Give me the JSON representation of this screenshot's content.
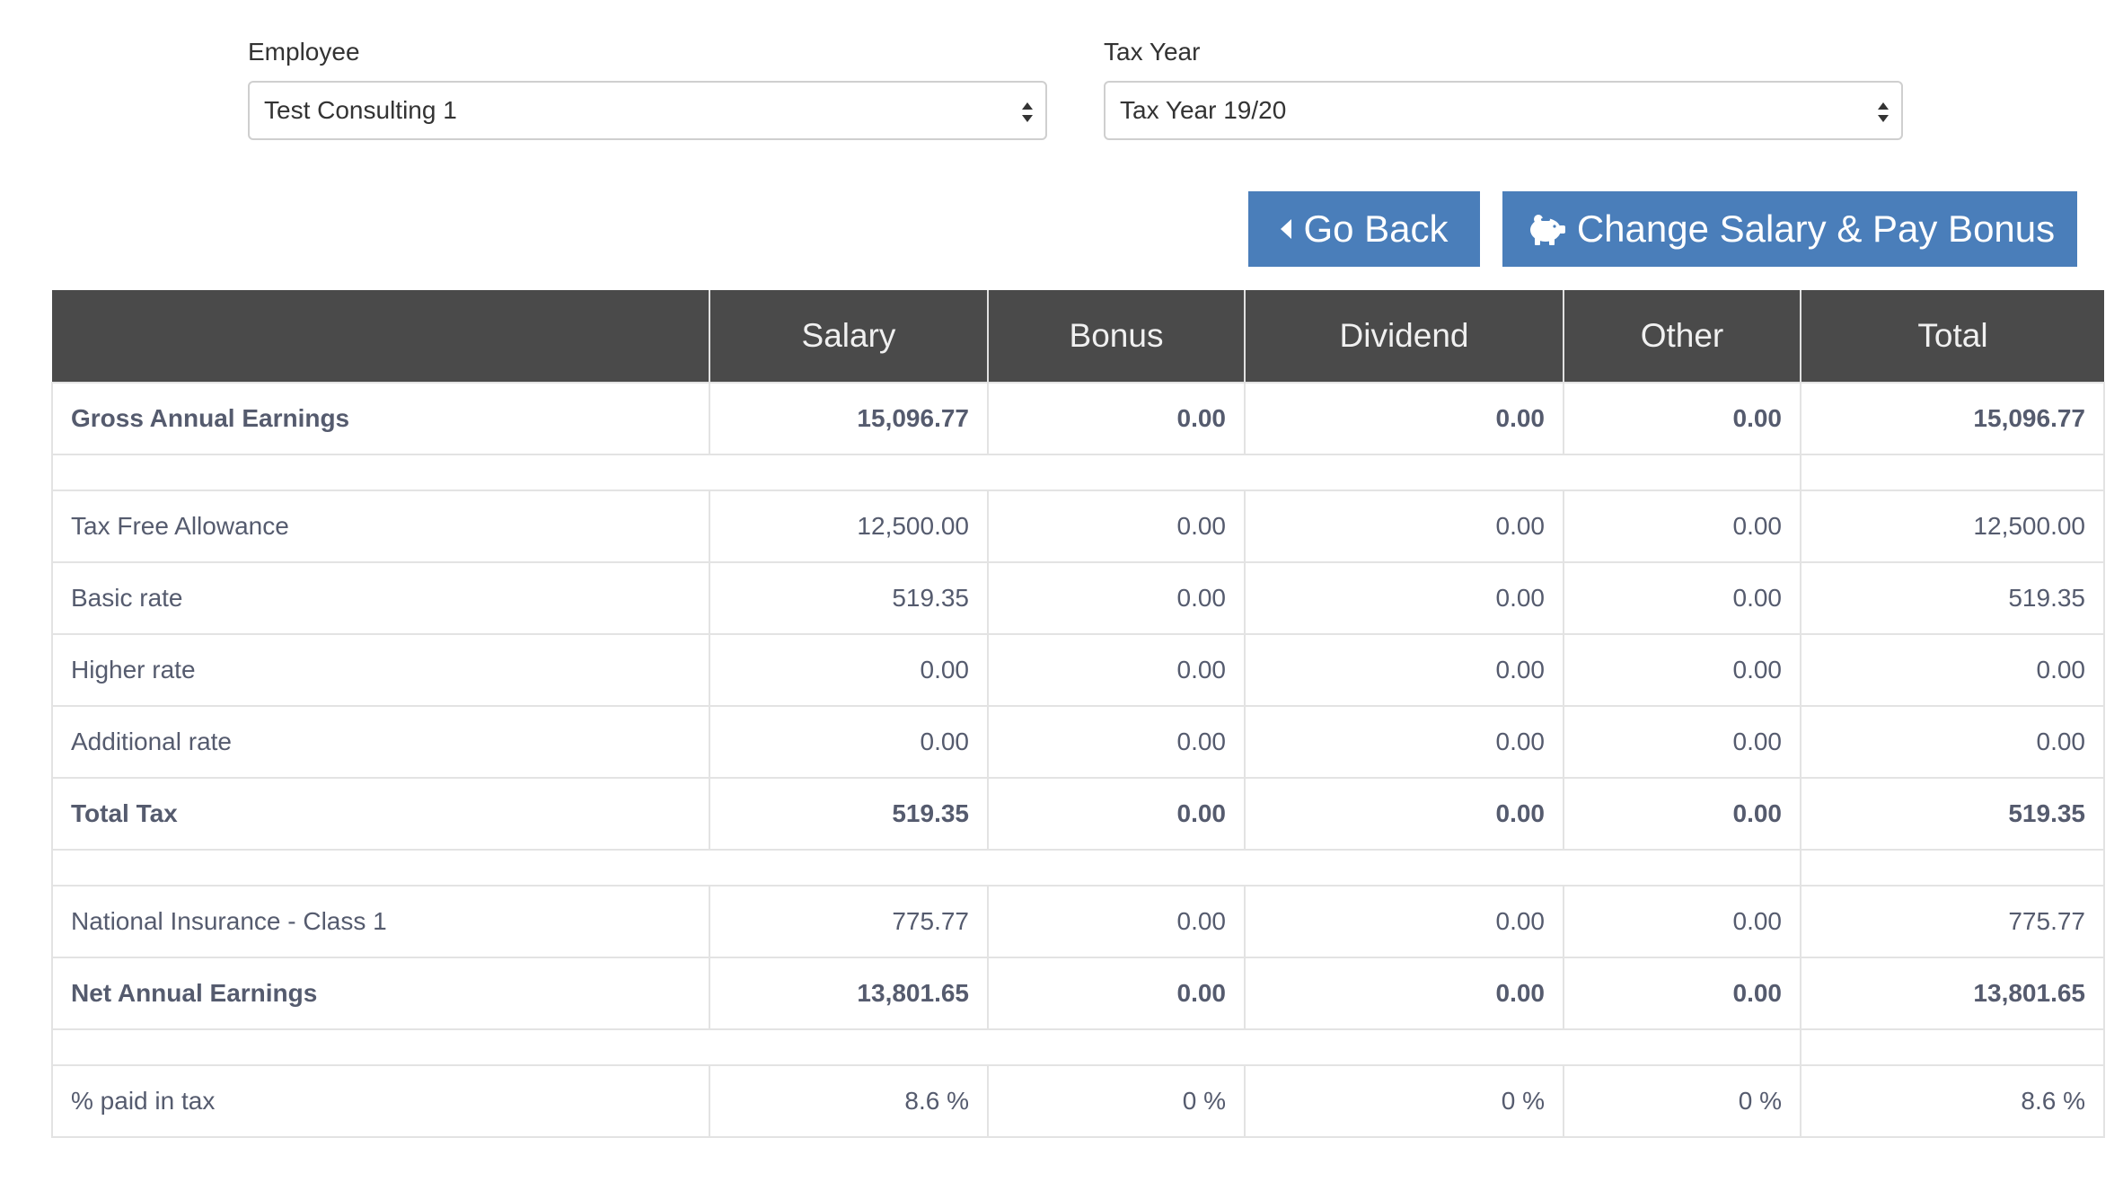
{
  "filters": {
    "employee": {
      "label": "Employee",
      "value": "Test Consulting 1"
    },
    "tax_year": {
      "label": "Tax Year",
      "value": "Tax Year 19/20"
    }
  },
  "buttons": {
    "go_back": {
      "label": "Go Back",
      "icon": "caret-left-icon"
    },
    "change_salary": {
      "label": "Change Salary & Pay Bonus",
      "icon": "piggy-bank-icon"
    }
  },
  "colors": {
    "button_bg": "#4a7eba",
    "header_bg": "#4a4a4a",
    "text": "#555b6e"
  },
  "table": {
    "columns": [
      "",
      "Salary",
      "Bonus",
      "Dividend",
      "Other",
      "Total"
    ],
    "rows": [
      {
        "label": "Gross Annual Earnings",
        "values": [
          "15,096.77",
          "0.00",
          "0.00",
          "0.00",
          "15,096.77"
        ]
      },
      {
        "label": "Tax Free Allowance",
        "values": [
          "12,500.00",
          "0.00",
          "0.00",
          "0.00",
          "12,500.00"
        ]
      },
      {
        "label": "Basic rate",
        "values": [
          "519.35",
          "0.00",
          "0.00",
          "0.00",
          "519.35"
        ]
      },
      {
        "label": "Higher rate",
        "values": [
          "0.00",
          "0.00",
          "0.00",
          "0.00",
          "0.00"
        ]
      },
      {
        "label": "Additional rate",
        "values": [
          "0.00",
          "0.00",
          "0.00",
          "0.00",
          "0.00"
        ]
      },
      {
        "label": "Total Tax",
        "values": [
          "519.35",
          "0.00",
          "0.00",
          "0.00",
          "519.35"
        ]
      },
      {
        "label": "National Insurance - Class 1",
        "values": [
          "775.77",
          "0.00",
          "0.00",
          "0.00",
          "775.77"
        ]
      },
      {
        "label": "Net Annual Earnings",
        "values": [
          "13,801.65",
          "0.00",
          "0.00",
          "0.00",
          "13,801.65"
        ]
      },
      {
        "label": "% paid in tax",
        "values": [
          "8.6 %",
          "0 %",
          "0 %",
          "0 %",
          "8.6 %"
        ]
      }
    ]
  }
}
